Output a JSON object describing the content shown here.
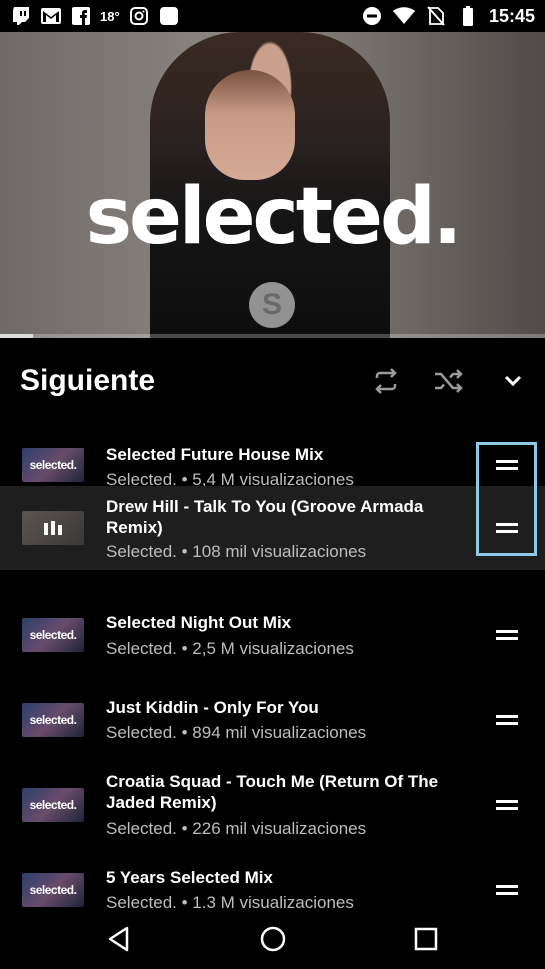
{
  "status_bar": {
    "icons_left": [
      "twitch-icon",
      "gmail-icon",
      "facebook-icon",
      "instagram-icon",
      "app-icon"
    ],
    "temperature": "18°",
    "icons_right": [
      "do-not-disturb-icon",
      "wifi-icon",
      "no-sim-icon",
      "battery-icon"
    ],
    "time": "15:45"
  },
  "video": {
    "brand_text": "selected.",
    "logo_letter": "S",
    "progress_fraction": 0.06
  },
  "queue": {
    "title": "Siguiente",
    "controls": [
      "repeat-icon",
      "shuffle-icon",
      "collapse-chevron-icon"
    ],
    "items": [
      {
        "title": "Selected Future House Mix",
        "subtitle": "Selected. • 5,4 M visualizaciones",
        "thumb_text": "selected.",
        "playing": false
      },
      {
        "title": "Drew Hill - Talk To You (Groove Armada Remix)",
        "subtitle": "Selected. • 108 mil visualizaciones",
        "thumb_text": "",
        "playing": true
      },
      {
        "title": "Selected Night Out Mix",
        "subtitle": "Selected. • 2,5 M visualizaciones",
        "thumb_text": "selected.",
        "playing": false
      },
      {
        "title": "Just Kiddin - Only For You",
        "subtitle": "Selected. • 894 mil visualizaciones",
        "thumb_text": "selected.",
        "playing": false
      },
      {
        "title": "Croatia Squad - Touch Me (Return Of The Jaded Remix)",
        "subtitle": "Selected. • 226 mil visualizaciones",
        "thumb_text": "selected.",
        "playing": false
      },
      {
        "title": "5 Years Selected Mix",
        "subtitle": "Selected. • 1,3 M visualizaciones",
        "thumb_text": "selected.",
        "playing": false
      }
    ]
  },
  "nav_bar": {
    "buttons": [
      "back-icon",
      "home-icon",
      "recents-icon"
    ]
  },
  "colors": {
    "background": "#000000",
    "playing_row": "#1e1e1e",
    "focus_outline": "#8ec9e8",
    "subtitle_text": "#bdbdbd"
  }
}
